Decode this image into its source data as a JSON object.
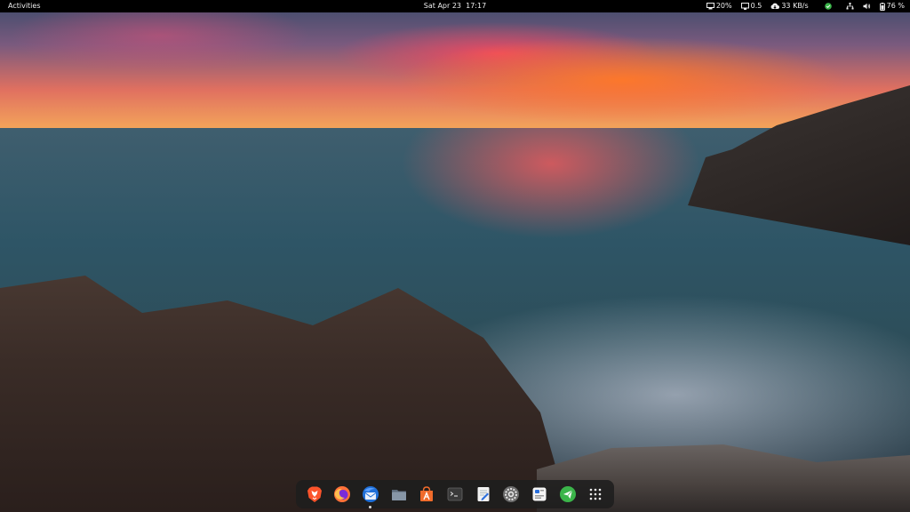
{
  "topbar": {
    "activities_label": "Activities",
    "date": "Sat Apr 23",
    "time": "17:17",
    "cpu_percent": "20%",
    "load": "0.5",
    "network_speed": "33 KB/s",
    "battery_percent": "76 %"
  },
  "dock": {
    "apps": [
      {
        "name": "brave-browser",
        "icon": "brave-lion-icon"
      },
      {
        "name": "firefox",
        "icon": "firefox-icon"
      },
      {
        "name": "thunderbird",
        "icon": "thunderbird-icon",
        "running": true
      },
      {
        "name": "files",
        "icon": "folder-icon"
      },
      {
        "name": "software",
        "icon": "app-store-icon"
      },
      {
        "name": "terminal",
        "icon": "terminal-icon"
      },
      {
        "name": "text-editor",
        "icon": "text-editor-icon"
      },
      {
        "name": "settings",
        "icon": "gear-icon"
      },
      {
        "name": "tweaks",
        "icon": "tweaks-icon"
      },
      {
        "name": "telegram",
        "icon": "paper-plane-icon"
      },
      {
        "name": "show-applications",
        "icon": "app-grid-icon"
      }
    ]
  },
  "colors": {
    "topbar_bg": "#000000",
    "dock_bg": "#1e1e1e",
    "status_green": "#3bb54a"
  }
}
